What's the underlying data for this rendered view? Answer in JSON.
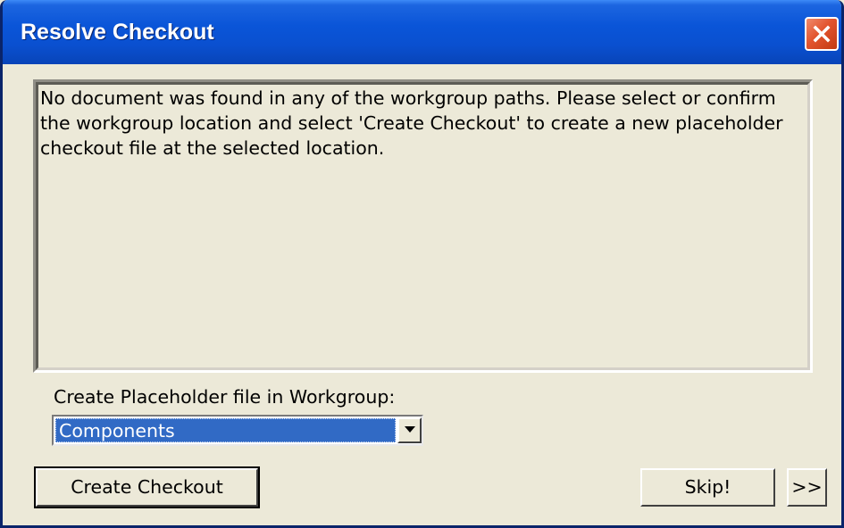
{
  "window": {
    "title": "Resolve Checkout"
  },
  "message": {
    "text": "No document was found in any of the workgroup paths.  Please select or confirm the workgroup location and select 'Create Checkout' to create a new placeholder checkout file at the selected location."
  },
  "workgroup": {
    "label": "Create Placeholder file in Workgroup:",
    "selected": "Components"
  },
  "buttons": {
    "create_checkout": "Create Checkout",
    "skip": "Skip!",
    "more": ">>"
  },
  "icons": {
    "close": "close-icon",
    "dropdown": "chevron-down-icon"
  },
  "colors": {
    "titlebar": "#0a55d8",
    "selection": "#316ac5",
    "close_button": "#e2542e",
    "face": "#ece9d8"
  }
}
